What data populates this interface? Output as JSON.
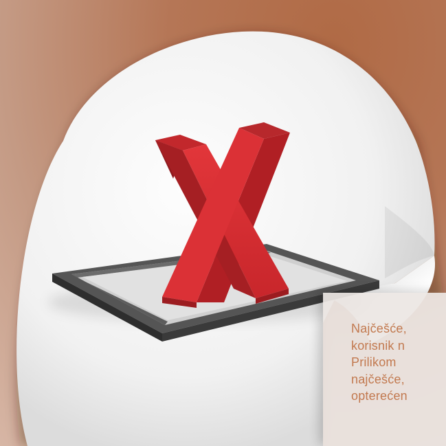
{
  "graphic": {
    "subject": "red-x-in-checkbox",
    "colors": {
      "background": "#b57656",
      "sticker": "#f4f4f4",
      "checkbox_frame": "#4a4a4a",
      "x_mark": "#d22a2e",
      "panel_text": "#c2794f"
    }
  },
  "info_panel": {
    "lines": [
      "Najčešće,",
      "korisnik  n",
      "Prilikom",
      "najčešće,",
      "opterećen"
    ]
  }
}
